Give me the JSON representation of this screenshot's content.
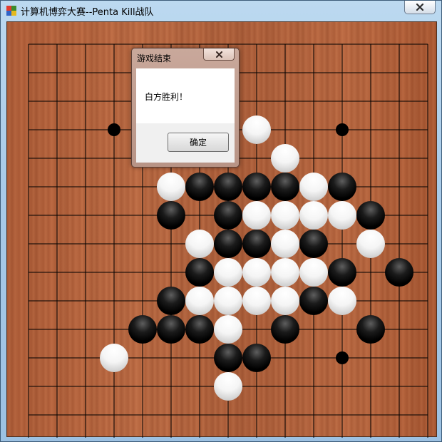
{
  "window": {
    "title": "计算机博弈大赛--Penta Kill战队",
    "icons": {
      "app": "app-icon",
      "close": "close-icon"
    }
  },
  "board": {
    "size": 15,
    "star_points": [
      [
        3,
        3
      ],
      [
        11,
        3
      ],
      [
        11,
        11
      ]
    ],
    "black_stones": [
      [
        6,
        5
      ],
      [
        7,
        5
      ],
      [
        8,
        5
      ],
      [
        9,
        5
      ],
      [
        11,
        5
      ],
      [
        5,
        6
      ],
      [
        7,
        6
      ],
      [
        12,
        6
      ],
      [
        7,
        7
      ],
      [
        8,
        7
      ],
      [
        10,
        7
      ],
      [
        6,
        8
      ],
      [
        11,
        8
      ],
      [
        13,
        8
      ],
      [
        5,
        9
      ],
      [
        10,
        9
      ],
      [
        4,
        10
      ],
      [
        5,
        10
      ],
      [
        6,
        10
      ],
      [
        9,
        10
      ],
      [
        12,
        10
      ],
      [
        7,
        11
      ],
      [
        8,
        11
      ]
    ],
    "white_stones": [
      [
        8,
        3
      ],
      [
        9,
        4
      ],
      [
        5,
        5
      ],
      [
        10,
        5
      ],
      [
        8,
        6
      ],
      [
        9,
        6
      ],
      [
        10,
        6
      ],
      [
        11,
        6
      ],
      [
        6,
        7
      ],
      [
        9,
        7
      ],
      [
        12,
        7
      ],
      [
        7,
        8
      ],
      [
        8,
        8
      ],
      [
        9,
        8
      ],
      [
        10,
        8
      ],
      [
        6,
        9
      ],
      [
        7,
        9
      ],
      [
        8,
        9
      ],
      [
        9,
        9
      ],
      [
        11,
        9
      ],
      [
        7,
        10
      ],
      [
        3,
        11
      ],
      [
        7,
        12
      ]
    ]
  },
  "dialog": {
    "title": "游戏结束",
    "message": "白方胜利！",
    "ok_label": "确定",
    "icons": {
      "close": "close-icon"
    }
  }
}
